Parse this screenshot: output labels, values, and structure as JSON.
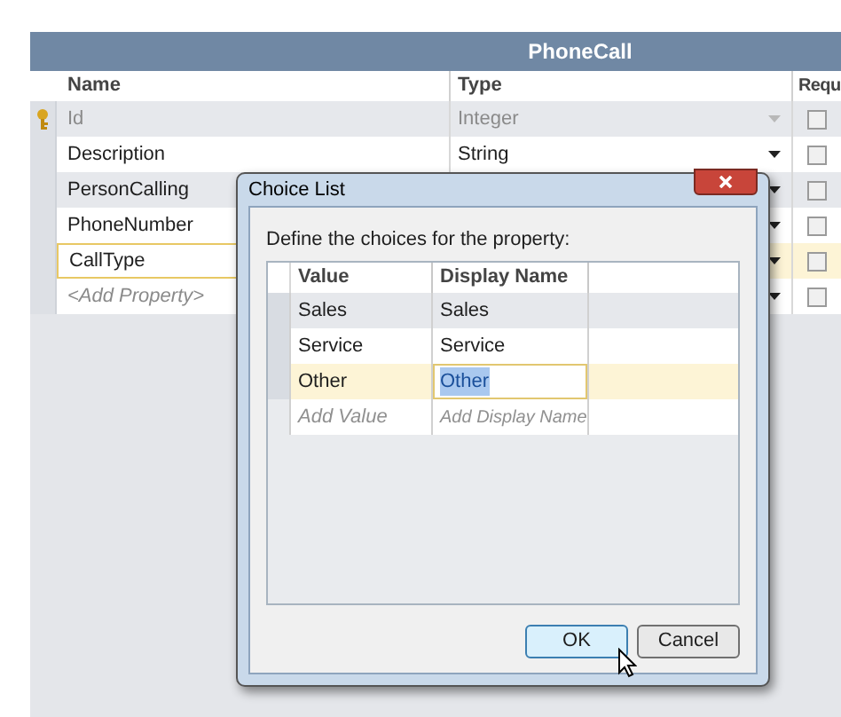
{
  "entity": {
    "title": "PhoneCall",
    "columns": [
      "Name",
      "Type",
      "Requ"
    ],
    "properties": [
      {
        "name": "Id",
        "type": "Integer",
        "key": true,
        "disabled": true,
        "selected": false,
        "required": false
      },
      {
        "name": "Description",
        "type": "String",
        "key": false,
        "disabled": false,
        "selected": false,
        "required": false
      },
      {
        "name": "PersonCalling",
        "key": false,
        "disabled": false,
        "selected": false,
        "required": false
      },
      {
        "name": "PhoneNumber",
        "key": false,
        "disabled": false,
        "selected": false,
        "required": false
      },
      {
        "name": "CallType",
        "key": false,
        "disabled": false,
        "selected": true,
        "required": false
      }
    ],
    "add_placeholder": "<Add Property>",
    "add_required": false
  },
  "dialog": {
    "title": "Choice List",
    "instruction": "Define the choices for the property:",
    "columns": [
      "Value",
      "Display Name"
    ],
    "choices": [
      {
        "value": "Sales",
        "display_name": "Sales",
        "selected": false
      },
      {
        "value": "Service",
        "display_name": "Service",
        "selected": false
      },
      {
        "value": "Other",
        "display_name": "Other",
        "selected": true
      }
    ],
    "value_placeholder": "Add Value",
    "display_placeholder": "Add Display Name",
    "buttons": [
      {
        "label": "OK",
        "default": true
      },
      {
        "label": "Cancel",
        "default": false
      }
    ]
  }
}
